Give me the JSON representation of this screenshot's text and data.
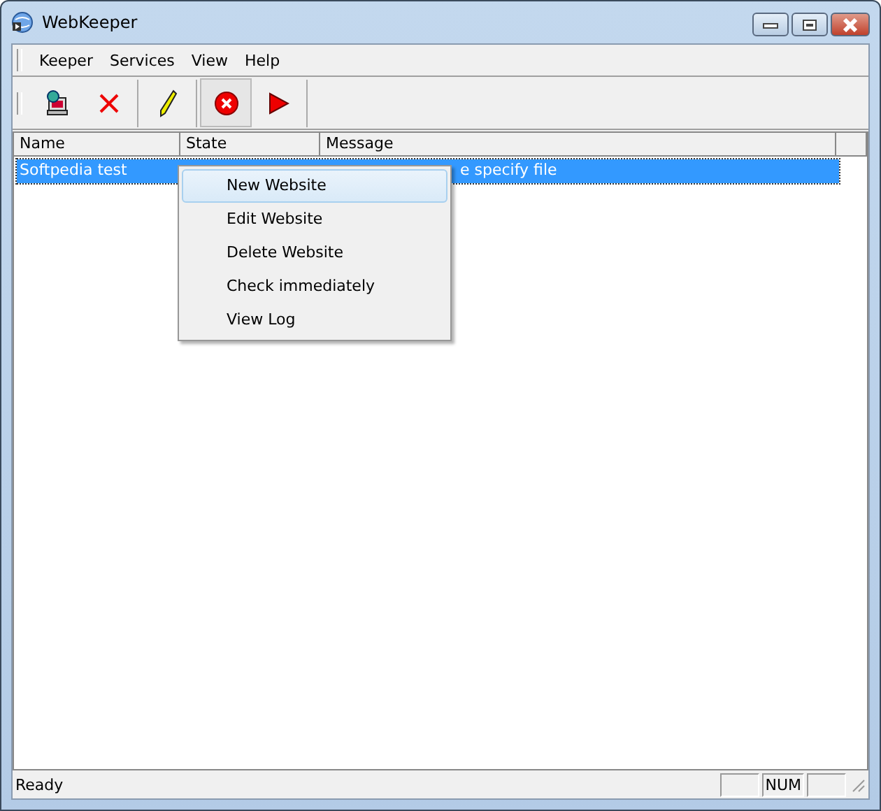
{
  "window": {
    "title": "WebKeeper"
  },
  "menu_bar": [
    "Keeper",
    "Services",
    "View",
    "Help"
  ],
  "toolbar": [
    {
      "kind": "add",
      "pressed": false
    },
    {
      "kind": "delete",
      "pressed": false
    },
    {
      "kind": "edit",
      "pressed": false
    },
    {
      "kind": "stop",
      "pressed": true
    },
    {
      "kind": "run",
      "pressed": false
    }
  ],
  "table": {
    "columns": [
      "Name",
      "State",
      "Message"
    ],
    "rows": [
      {
        "name": "Softpedia test",
        "message": "e specify file",
        "selected": true
      }
    ]
  },
  "context_menu": [
    {
      "label": "New Website",
      "selected": true
    },
    {
      "label": "Edit Website",
      "selected": false
    },
    {
      "label": "Delete Website",
      "selected": false
    },
    {
      "label": "Check immediately",
      "selected": false
    },
    {
      "label": "View Log",
      "selected": false
    }
  ],
  "status_bar": {
    "text": "Ready",
    "indicator": "NUM"
  }
}
